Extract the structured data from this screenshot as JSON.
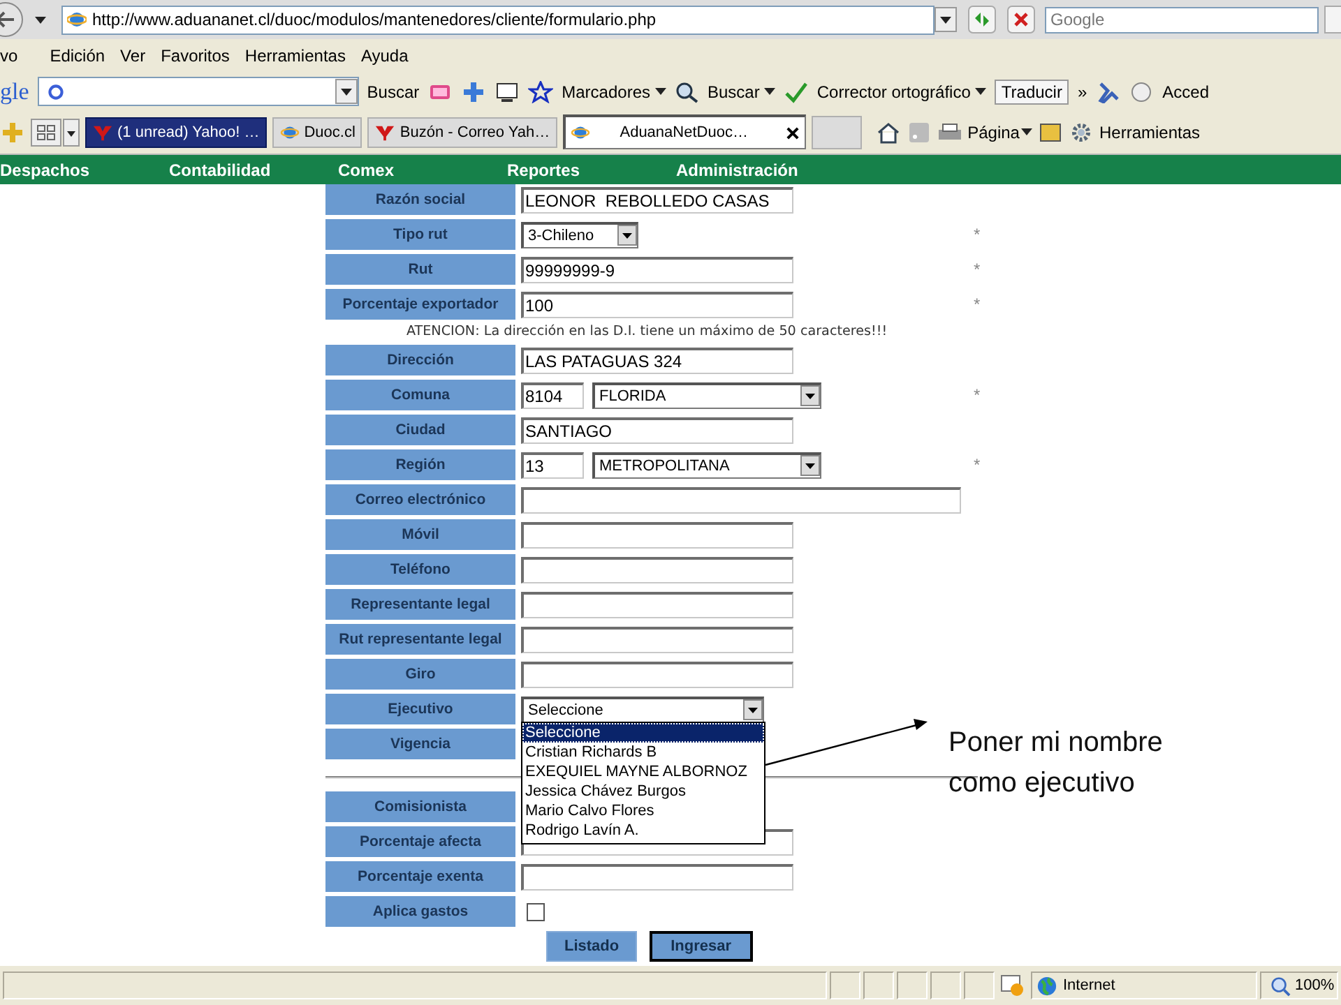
{
  "browser": {
    "address": "http://www.aduananet.cl/duoc/modulos/mantenedores/cliente/formulario.php",
    "search_placeholder": "Google",
    "menu": [
      "vo",
      "Edición",
      "Ver",
      "Favoritos",
      "Herramientas",
      "Ayuda"
    ],
    "google_toolbar": {
      "logo": "gle",
      "search_button": "Buscar",
      "bookmarks": "Marcadores",
      "find": "Buscar",
      "spellcheck": "Corrector ortográfico",
      "translate": "Traducir",
      "more": "»",
      "signin": "Acced"
    },
    "tabs": [
      {
        "label": "(1 unread) Yahoo! …",
        "selected": false,
        "highlighted": true
      },
      {
        "label": "Duoc.cl",
        "selected": false,
        "highlighted": false
      },
      {
        "label": "Buzón - Correo Yah…",
        "selected": false,
        "highlighted": false
      },
      {
        "label": "AduanaNetDuoc…",
        "selected": true,
        "highlighted": false
      }
    ],
    "command_bar": {
      "page": "Página",
      "tools": "Herramientas"
    }
  },
  "nav": [
    "Despachos",
    "Contabilidad",
    "Comex",
    "Reportes",
    "Administración"
  ],
  "form": {
    "rows": [
      {
        "kind": "text",
        "label": "Razón social",
        "value": "LEONOR  REBOLLEDO CASAS"
      },
      {
        "kind": "short_select",
        "label": "Tipo rut",
        "value": "3-Chileno",
        "mark": "*"
      },
      {
        "kind": "text",
        "label": "Rut",
        "value": "99999999-9",
        "mark": "*"
      },
      {
        "kind": "text",
        "label": "Porcentaje exportador",
        "value": "100",
        "mark": "*"
      },
      {
        "kind": "notice",
        "text": "ATENCION: La dirección en las D.I. tiene un máximo de 50 caracteres!!!"
      },
      {
        "kind": "text",
        "label": "Dirección",
        "value": "LAS PATAGUAS 324"
      },
      {
        "kind": "code_select",
        "label": "Comuna",
        "code": "8104",
        "value": "FLORIDA",
        "mark": "*"
      },
      {
        "kind": "text",
        "label": "Ciudad",
        "value": "SANTIAGO"
      },
      {
        "kind": "code_select",
        "label": "Región",
        "code": "13",
        "value": "METROPOLITANA",
        "mark": "*"
      },
      {
        "kind": "wide_text",
        "label": "Correo electrónico"
      },
      {
        "kind": "text",
        "label": "Móvil"
      },
      {
        "kind": "text",
        "label": "Teléfono"
      },
      {
        "kind": "text",
        "label": "Representante legal"
      },
      {
        "kind": "text",
        "label": "Rut representante legal"
      },
      {
        "kind": "text",
        "label": "Giro"
      },
      {
        "kind": "select",
        "label": "Ejecutivo",
        "value": "Seleccione",
        "open": true,
        "options": [
          {
            "label": "Seleccione",
            "selected": true
          },
          {
            "label": "Cristian Richards B",
            "selected": false
          },
          {
            "label": "EXEQUIEL MAYNE ALBORNOZ",
            "selected": false
          },
          {
            "label": "Jessica Chávez Burgos",
            "selected": false
          },
          {
            "label": "Mario Calvo Flores",
            "selected": false
          },
          {
            "label": "Rodrigo Lavín A.",
            "selected": false
          }
        ]
      },
      {
        "kind": "covered",
        "label": "Vigencia"
      },
      {
        "kind": "divider"
      },
      {
        "kind": "covered",
        "label": "Comisionista"
      },
      {
        "kind": "text",
        "label": "Porcentaje afecta"
      },
      {
        "kind": "text",
        "label": "Porcentaje exenta"
      },
      {
        "kind": "checkbox",
        "label": "Aplica gastos",
        "checked": false
      }
    ]
  },
  "buttons": [
    {
      "label": "Listado",
      "focused": false
    },
    {
      "label": "Ingresar",
      "focused": true
    }
  ],
  "annotation": {
    "text": "Poner mi nombre como ejecutivo"
  },
  "status_bar": {
    "zone": "Internet",
    "zoom": "100%"
  }
}
